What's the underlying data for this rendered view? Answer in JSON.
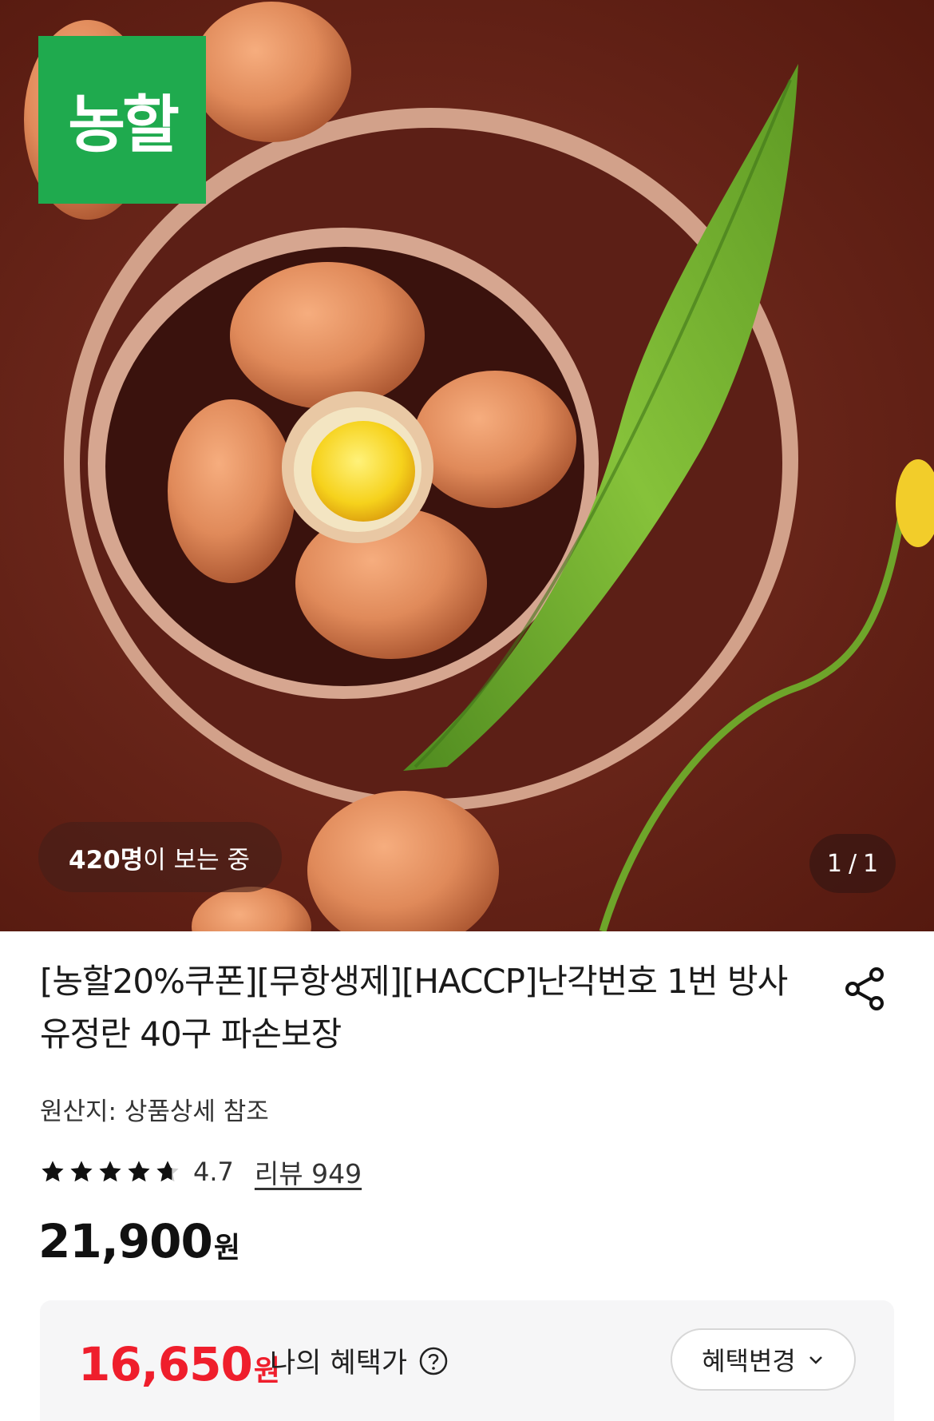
{
  "hero": {
    "logo_text": "농할",
    "viewer_count": "420명",
    "viewer_suffix": "이 보는 중",
    "pager_current": "1",
    "pager_separator": "/",
    "pager_total": "1"
  },
  "product": {
    "title": "[농할20%쿠폰][무항생제][HACCP]난각번호 1번 방사 유정란 40구 파손보장",
    "origin": "원산지: 상품상세 참조",
    "rating": "4.7",
    "rating_stars": 4.7,
    "review_link": "리뷰 949",
    "price": "21,900",
    "price_unit": "원"
  },
  "benefit": {
    "price": "16,650",
    "price_unit": "원",
    "label": "나의 혜택가",
    "change_button": "혜택변경"
  },
  "icons": {
    "share": "share-icon",
    "help": "question-circle-icon",
    "chevron": "chevron-down-icon",
    "star": "star-icon"
  },
  "colors": {
    "brand_green": "#1faa4e",
    "benefit_red": "#ef1e2c",
    "hero_background": "#6a261a"
  }
}
